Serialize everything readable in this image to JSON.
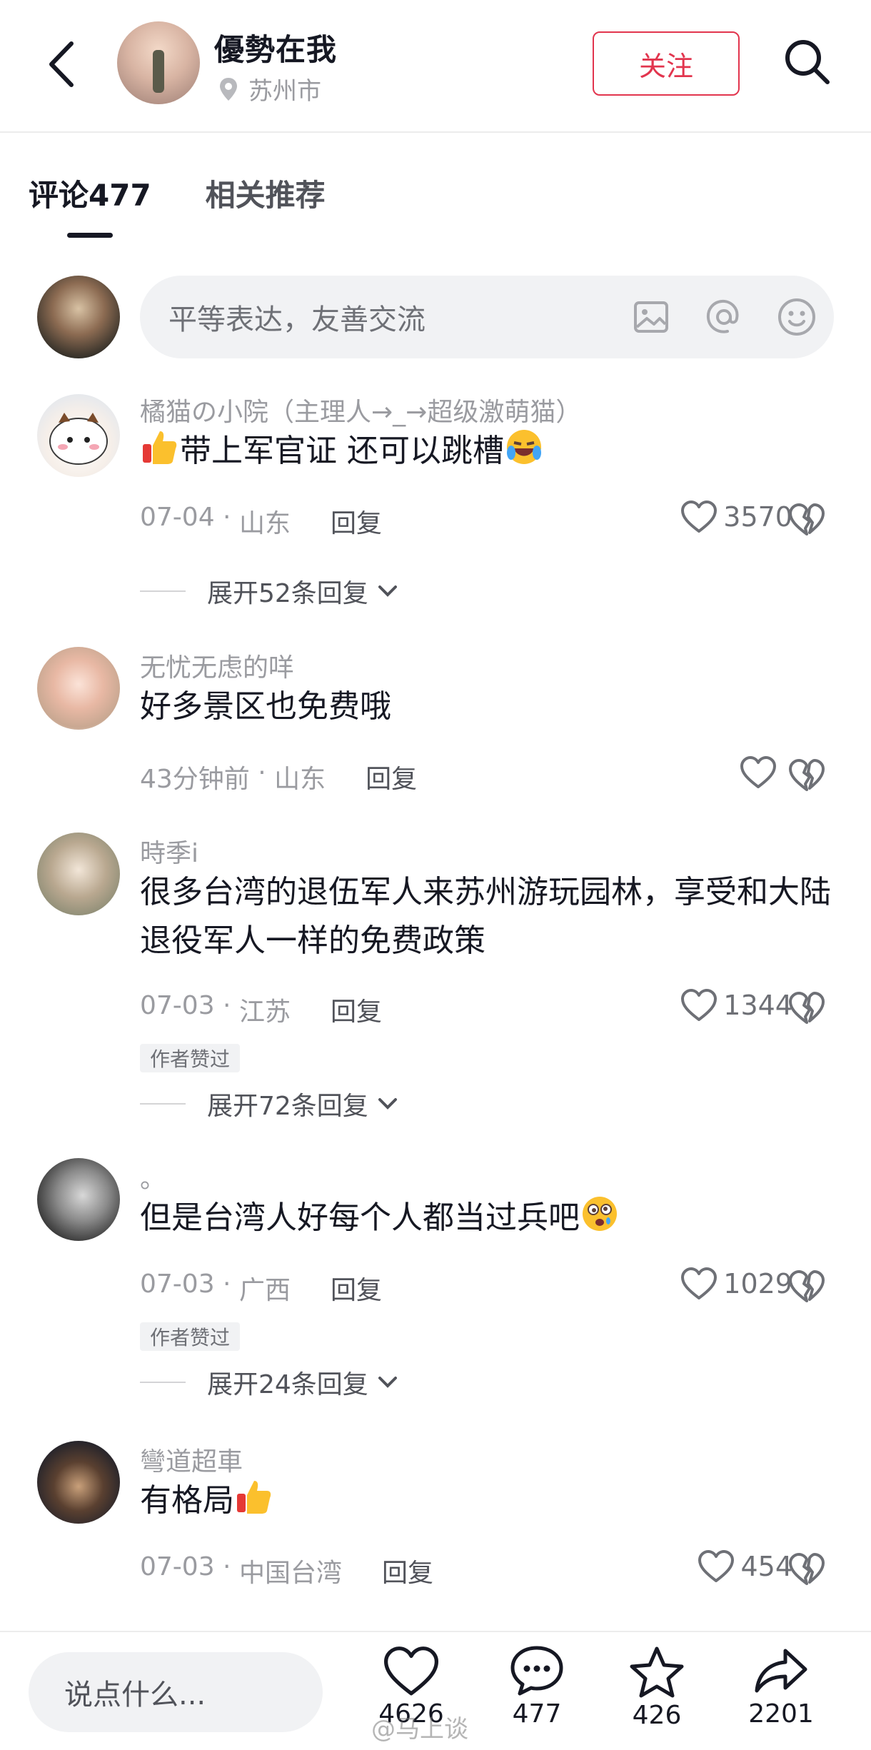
{
  "header": {
    "user_name": "優勢在我",
    "location": "苏州市",
    "follow_label": "关注"
  },
  "tabs": [
    {
      "label": "评论477",
      "active": true
    },
    {
      "label": "相关推荐",
      "active": false
    }
  ],
  "comment_input": {
    "placeholder": "平等表达，友善交流",
    "icons": [
      "image-icon",
      "at-icon",
      "emoji-icon"
    ]
  },
  "comments": [
    {
      "name": "橘猫の小院（主理人→_→超级激萌猫）",
      "text": "带上军官证 还可以跳槽",
      "date": "07-04",
      "region": "山东",
      "reply_label": "回复",
      "likes": "3570",
      "author_liked": "",
      "expand": "展开52条回复"
    },
    {
      "name": "无忧无虑的咩",
      "text": "好多景区也免费哦",
      "date": "43分钟前",
      "region": "山东",
      "reply_label": "回复",
      "likes": "",
      "author_liked": "",
      "expand": ""
    },
    {
      "name": "時季i",
      "text": "很多台湾的退伍军人来苏州游玩园林，享受和大陆退役军人一样的免费政策",
      "date": "07-03",
      "region": "江苏",
      "reply_label": "回复",
      "likes": "1344",
      "author_liked": "作者赞过",
      "expand": "展开72条回复"
    },
    {
      "name": "。",
      "text": "但是台湾人好每个人都当过兵吧",
      "date": "07-03",
      "region": "广西",
      "reply_label": "回复",
      "likes": "1029",
      "author_liked": "作者赞过",
      "expand": "展开24条回复"
    },
    {
      "name": "彎道超車",
      "text": "有格局",
      "date": "07-03",
      "region": "中国台湾",
      "reply_label": "回复",
      "likes": "454",
      "author_liked": "",
      "expand": ""
    }
  ],
  "bottom_bar": {
    "say_placeholder": "说点什么...",
    "likes": "4626",
    "comments": "477",
    "favorites": "426",
    "shares": "2201",
    "watermark": "@马上谈"
  },
  "colors": {
    "accent": "#e2354e",
    "text_primary": "#161823",
    "text_secondary": "#9a9ba0"
  }
}
